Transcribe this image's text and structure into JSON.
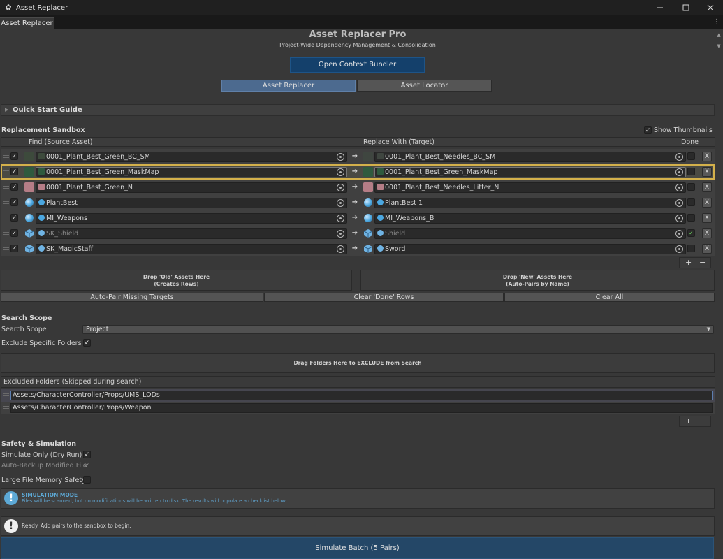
{
  "window": {
    "title": "Asset Replacer",
    "tab": "Asset Replacer"
  },
  "header": {
    "title": "Asset Replacer Pro",
    "subtitle": "Project-Wide Dependency Management & Consolidation",
    "bundler_button": "Open Context Bundler",
    "tabs": [
      "Asset Replacer",
      "Asset Locator"
    ],
    "active_tab": "Asset Replacer"
  },
  "quick_start": "Quick Start Guide",
  "sandbox": {
    "title": "Replacement Sandbox",
    "show_thumbnails_label": "Show Thumbnails",
    "show_thumbnails": true,
    "col_find": "Find (Source Asset)",
    "col_replace": "Replace With (Target)",
    "col_done": "Done",
    "rows": [
      {
        "enabled": true,
        "source": "0001_Plant_Best_Green_BC_SM",
        "target": "0001_Plant_Best_Needles_BC_SM",
        "done": false,
        "src_color": "#3d4a3c",
        "tgt_color": "#3f4640",
        "src_kind": "texture",
        "tgt_kind": "texture"
      },
      {
        "enabled": true,
        "source": "0001_Plant_Best_Green_MaskMap",
        "target": "0001_Plant_Best_Green_MaskMap",
        "done": false,
        "src_color": "#2f5a3e",
        "tgt_color": "#2f5a3e",
        "src_kind": "texture",
        "tgt_kind": "texture"
      },
      {
        "enabled": true,
        "source": "0001_Plant_Best_Green_N",
        "target": "0001_Plant_Best_Needles_Litter_N",
        "done": false,
        "src_color": "#b57d86",
        "tgt_color": "#b57d86",
        "src_kind": "texture",
        "tgt_kind": "texture"
      },
      {
        "enabled": true,
        "source": "PlantBest",
        "target": "PlantBest 1",
        "done": false,
        "src_color": "#4ba7e0",
        "tgt_color": "#4ba7e0",
        "src_kind": "material",
        "tgt_kind": "material"
      },
      {
        "enabled": true,
        "source": "MI_Weapons",
        "target": "MI_Weapons_B",
        "done": false,
        "src_color": "#4ba7e0",
        "tgt_color": "#4ba7e0",
        "src_kind": "material",
        "tgt_kind": "material"
      },
      {
        "enabled": true,
        "source": "SK_Shield",
        "target": "Shield",
        "done": true,
        "src_color": "#6fb3e3",
        "tgt_color": "#6fb3e3",
        "src_kind": "mesh",
        "tgt_kind": "mesh"
      },
      {
        "enabled": true,
        "source": "SK_MagicStaff",
        "target": "Sword",
        "done": false,
        "src_color": "#6fb3e3",
        "tgt_color": "#6fb3e3",
        "src_kind": "mesh",
        "tgt_kind": "mesh"
      }
    ],
    "remove_label": "X",
    "add_label": "+",
    "minus_label": "−",
    "drop_old": [
      "Drop 'Old' Assets Here",
      "(Creates Rows)"
    ],
    "drop_new": [
      "Drop 'New' Assets Here",
      "(Auto-Pairs by Name)"
    ],
    "auto_pair": "Auto-Pair Missing Targets",
    "clear_done": "Clear 'Done' Rows",
    "clear_all": "Clear All"
  },
  "scope": {
    "title": "Search Scope",
    "label": "Search Scope",
    "value": "Project",
    "exclude_label": "Exclude Specific Folders",
    "exclude": true,
    "drop_zone": "Drag Folders Here to EXCLUDE from Search",
    "excluded_header": "Excluded Folders (Skipped during search)",
    "folders": [
      "Assets/CharacterController/Props/UMS_LODs",
      "Assets/CharacterController/Props/Weapon"
    ]
  },
  "safety": {
    "title": "Safety & Simulation",
    "simulate_label": "Simulate Only (Dry Run)",
    "simulate": true,
    "backup_label": "Auto-Backup Modified File",
    "backup": true,
    "memory_label": "Large File Memory Safety",
    "memory": false
  },
  "sim_notice": {
    "title": "SIMULATION MODE",
    "body": "Files will be scanned, but no modifications will be written to disk. The results will populate a checklist below.",
    "color": "#5da9d6"
  },
  "status": "Ready. Add pairs to the sandbox to begin.",
  "run_button": "Simulate Batch (5 Pairs)"
}
